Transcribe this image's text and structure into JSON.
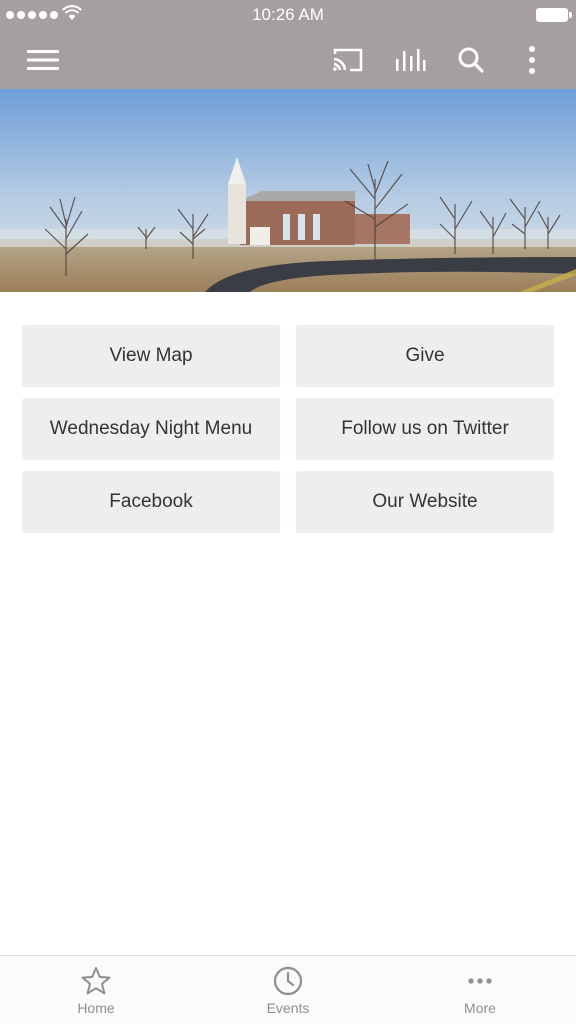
{
  "status_bar": {
    "time": "10:26 AM"
  },
  "toolbar": {
    "icons": [
      "menu-icon",
      "cast-icon",
      "audio-bars-icon",
      "search-icon",
      "more-vertical-icon"
    ],
    "color": "#a59ea3"
  },
  "hero": {
    "description_icon": "church-photo"
  },
  "buttons": [
    {
      "label": "View Map"
    },
    {
      "label": "Give"
    },
    {
      "label": "Wednesday Night Menu"
    },
    {
      "label": "Follow us on Twitter"
    },
    {
      "label": "Facebook"
    },
    {
      "label": "Our Website"
    }
  ],
  "tabbar": {
    "tabs": [
      {
        "label": "Home",
        "icon": "star-icon"
      },
      {
        "label": "Events",
        "icon": "clock-icon"
      },
      {
        "label": "More",
        "icon": "more-horizontal-icon"
      }
    ]
  }
}
